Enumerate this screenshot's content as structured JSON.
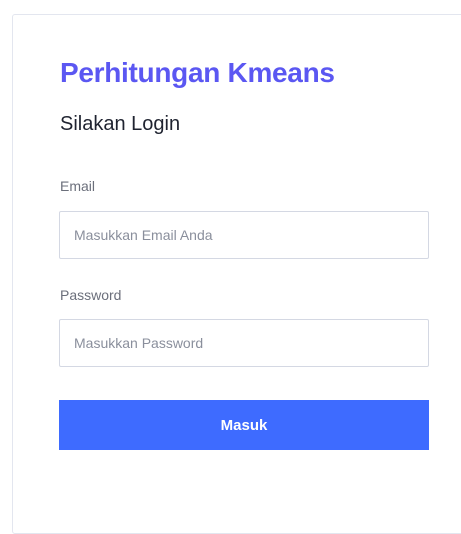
{
  "login": {
    "title": "Perhitungan Kmeans",
    "subtitle": "Silakan Login",
    "email_label": "Email",
    "email_placeholder": "Masukkan Email Anda",
    "email_value": "",
    "password_label": "Password",
    "password_placeholder": "Masukkan Password",
    "password_value": "",
    "submit_label": "Masuk"
  },
  "colors": {
    "title": "#5b57f2",
    "button_bg": "#3e6bff",
    "border": "#d4d8e3"
  }
}
